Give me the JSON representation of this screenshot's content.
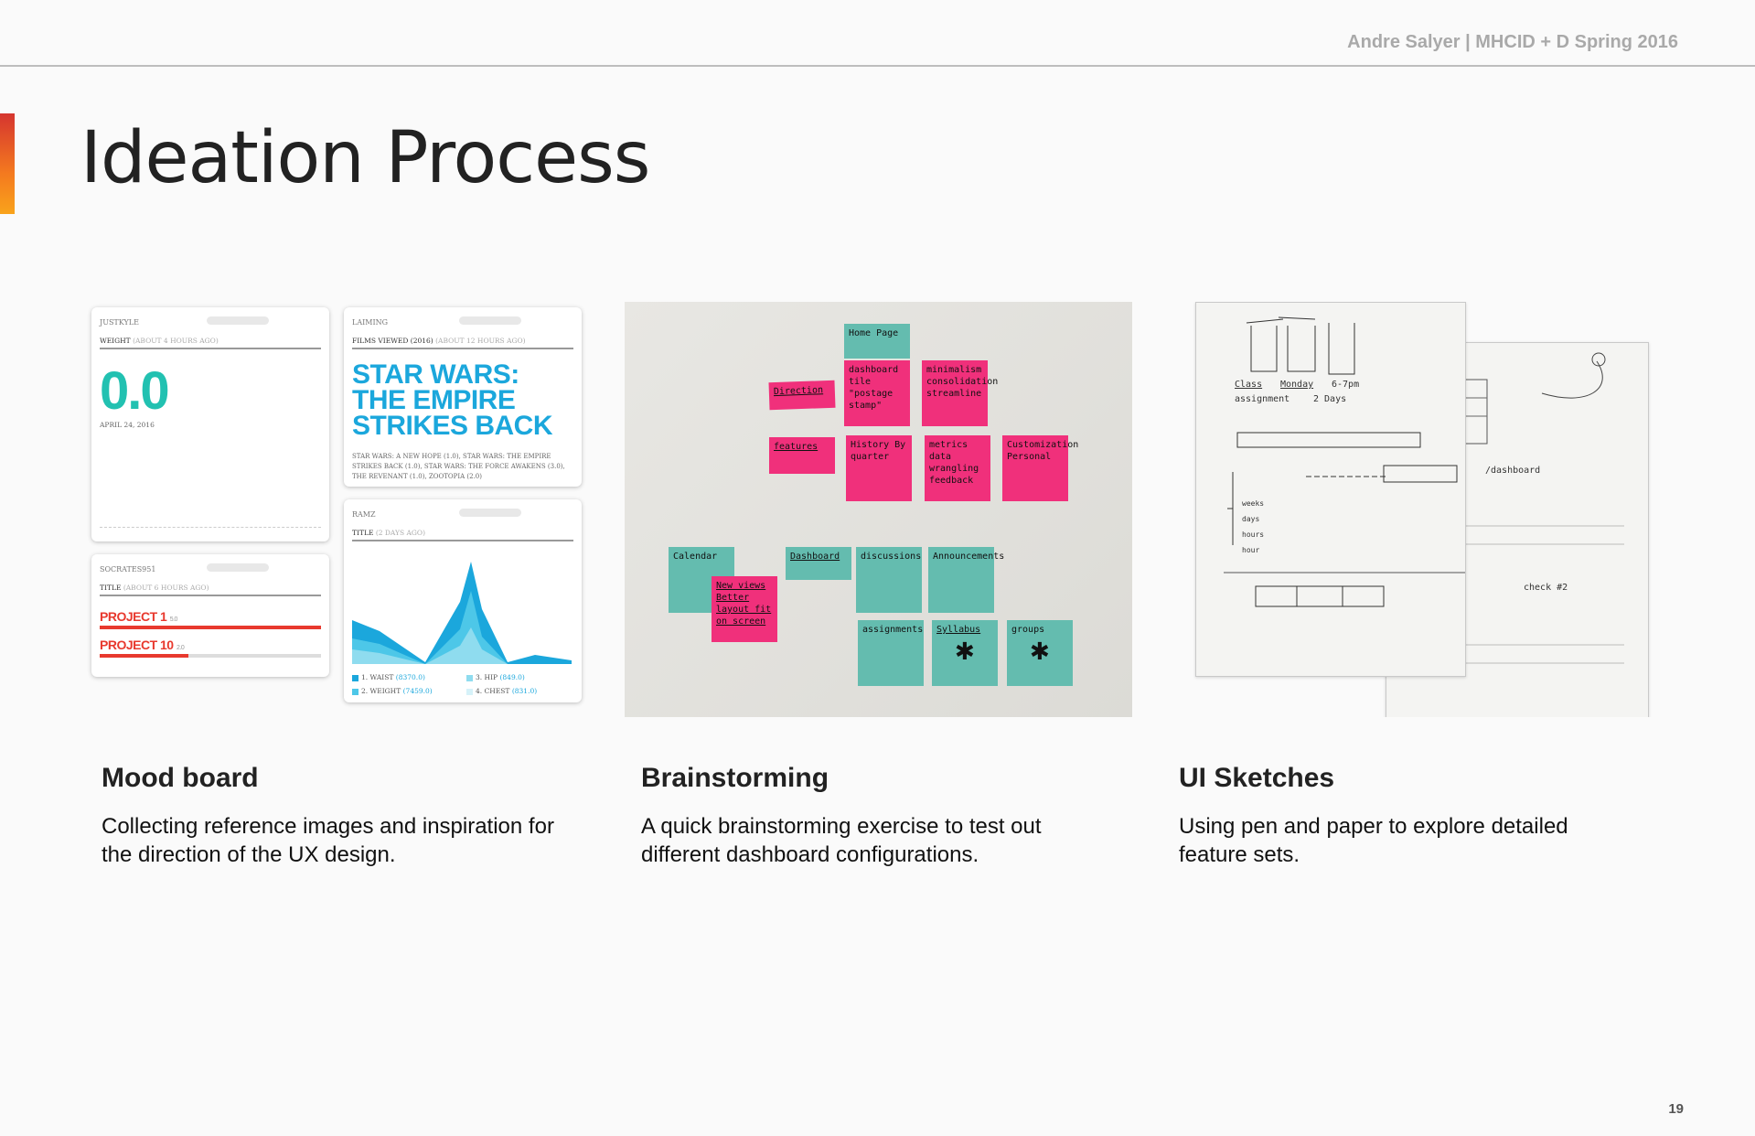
{
  "header": {
    "author": "Andre Salyer | MHCID + D Spring 2016"
  },
  "slide": {
    "title": "Ideation Process",
    "page_number": "19"
  },
  "sections": [
    {
      "title": "Mood board",
      "description": "Collecting reference images and inspiration for the direction of the UX design."
    },
    {
      "title": "Brainstorming",
      "description": "A quick brainstorming exercise to test out different dashboard configurations."
    },
    {
      "title": "UI Sketches",
      "description": "Using pen and paper to explore detailed feature sets."
    }
  ],
  "moodboard": {
    "weight_widget": {
      "user": "JUSTKYLE",
      "label": "WEIGHT",
      "ago": "(ABOUT 4 HOURS AGO)",
      "value": "0.0",
      "date": "APRIL 24, 2016"
    },
    "films_widget": {
      "user": "LAIMING",
      "label": "FILMS VIEWED (2016)",
      "ago": "(ABOUT 12 HOURS AGO)",
      "headline": "STAR WARS: THE EMPIRE STRIKES BACK",
      "list": "STAR WARS: A NEW HOPE (1.0), STAR WARS: THE EMPIRE STRIKES BACK (1.0), STAR WARS: THE FORCE AWAKENS (3.0), THE REVENANT (1.0), ZOOTOPIA (2.0)"
    },
    "projects_widget": {
      "user": "SOCRATES951",
      "label": "TITLE",
      "ago": "(ABOUT 6 HOURS AGO)",
      "projects": [
        {
          "name": "PROJECT 1",
          "value": "5.0",
          "fill": 1.0
        },
        {
          "name": "PROJECT 10",
          "value": "2.0",
          "fill": 0.4
        }
      ]
    },
    "chart_widget": {
      "user": "RAMZ",
      "label": "TITLE",
      "ago": "(2 DAYS AGO)",
      "legend": [
        {
          "name": "1. WAIST",
          "value": "(8370.0)",
          "color": "#1ba7dc"
        },
        {
          "name": "2. WEIGHT",
          "value": "(7459.0)",
          "color": "#4dc7e8"
        },
        {
          "name": "3. HIP",
          "value": "(849.0)",
          "color": "#8fdcef"
        },
        {
          "name": "4. CHEST",
          "value": "(831.0)",
          "color": "#d6f2f9"
        }
      ]
    }
  },
  "brainstorm_notes": {
    "home": "Home Page",
    "dashboard_tile": "dashboard tile \"postage stamp\"",
    "minimalism": "minimalism consolidation streamline",
    "direction": "Direction",
    "features": "features",
    "history": "History By quarter",
    "metrics": "metrics data wrangling feedback",
    "customization": "Customization Personal",
    "calendar": "Calendar",
    "new_views": "New views Better layout fit on screen",
    "dashboard": "Dashboard",
    "discussions": "discussions",
    "announcements": "Announcements",
    "assignments": "assignments",
    "syllabus": "Syllabus",
    "groups": "groups"
  },
  "sketch": {
    "class": "Class",
    "monday": "Monday",
    "time": "6-7pm",
    "assignment": "assignment",
    "two_days": "2 Days",
    "weeks": "weeks",
    "days": "days",
    "hours": "hours",
    "hour": "hour",
    "dashboard": "/dashboard",
    "check": "check #2"
  }
}
